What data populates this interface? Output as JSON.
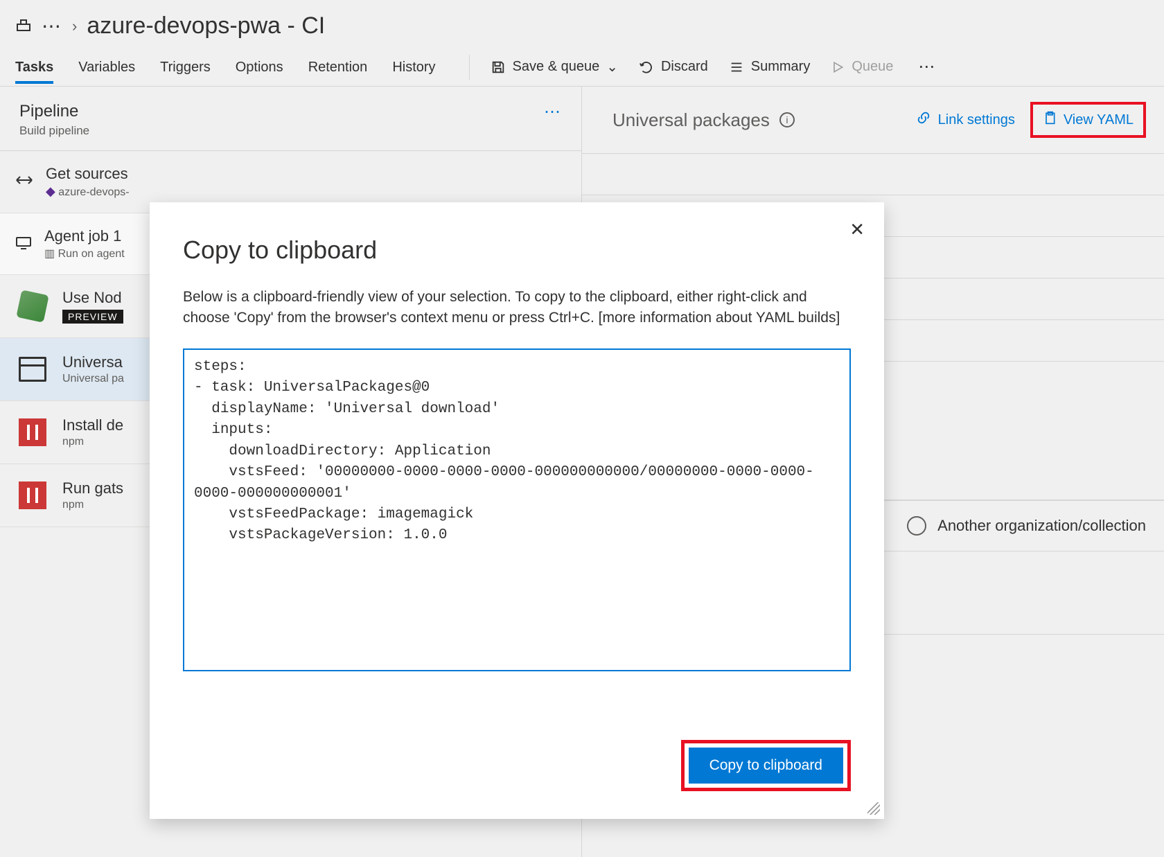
{
  "breadcrumb": {
    "title": "azure-devops-pwa - CI"
  },
  "tabs": {
    "items": [
      "Tasks",
      "Variables",
      "Triggers",
      "Options",
      "Retention",
      "History"
    ],
    "active": 0
  },
  "actions": {
    "save_queue": "Save & queue",
    "discard": "Discard",
    "summary": "Summary",
    "queue": "Queue"
  },
  "pipeline": {
    "title": "Pipeline",
    "subtitle": "Build pipeline"
  },
  "get_sources": {
    "title": "Get sources",
    "repo": "azure-devops-"
  },
  "agent_job": {
    "title": "Agent job 1",
    "subtitle": "Run on agent"
  },
  "tasks": [
    {
      "title": "Use Nod",
      "badge": "PREVIEW",
      "icon": "node"
    },
    {
      "title": "Universa",
      "sub": "Universal pa",
      "icon": "box",
      "selected": true
    },
    {
      "title": "Install de",
      "sub": "npm",
      "icon": "npm"
    },
    {
      "title": "Run gats",
      "sub": "npm",
      "icon": "npm"
    }
  ],
  "right": {
    "title": "Universal packages",
    "link_settings": "Link settings",
    "view_yaml": "View YAML",
    "radio_label": "Another organization/collection"
  },
  "modal": {
    "title": "Copy to clipboard",
    "desc": "Below is a clipboard-friendly view of your selection. To copy to the clipboard, either right-click and choose 'Copy' from the browser's context menu or press Ctrl+C. [more information about YAML builds]",
    "yaml": "steps:\n- task: UniversalPackages@0\n  displayName: 'Universal download'\n  inputs:\n    downloadDirectory: Application\n    vstsFeed: '00000000-0000-0000-0000-000000000000/00000000-0000-0000-0000-000000000001'\n    vstsFeedPackage: imagemagick\n    vstsPackageVersion: 1.0.0",
    "copy_button": "Copy to clipboard"
  }
}
